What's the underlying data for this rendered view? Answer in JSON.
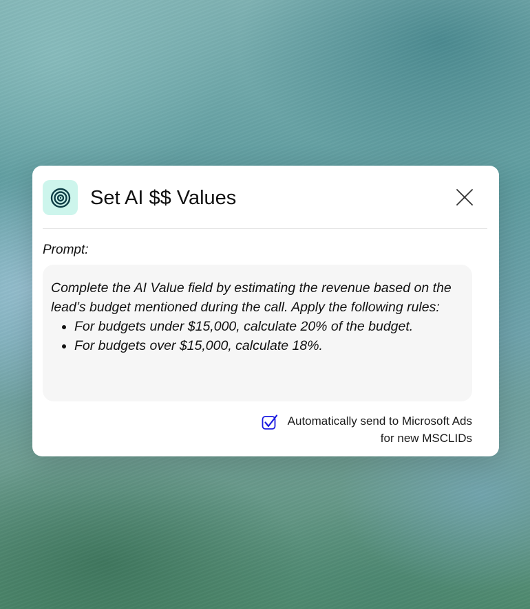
{
  "dialog": {
    "title": "Set AI $$ Values",
    "icon": "target-icon",
    "close_icon": "close-icon",
    "prompt_label": "Prompt:",
    "prompt": {
      "intro": "Complete the AI Value field by estimating the revenue based on the lead’s budget mentioned during the call. Apply the following rules:",
      "rules": [
        "For budgets under $15,000, calculate 20% of the budget.",
        "For budgets over $15,000, calculate 18%."
      ]
    },
    "auto_send": {
      "checked": true,
      "line1": "Automatically send to Microsoft Ads",
      "line2": "for new MSCLIDs"
    }
  },
  "colors": {
    "icon_bg": "#cdf5ec",
    "icon_stroke": "#0d3d45",
    "checkbox": "#1a1ae0",
    "prompt_bg": "#f6f6f6"
  }
}
